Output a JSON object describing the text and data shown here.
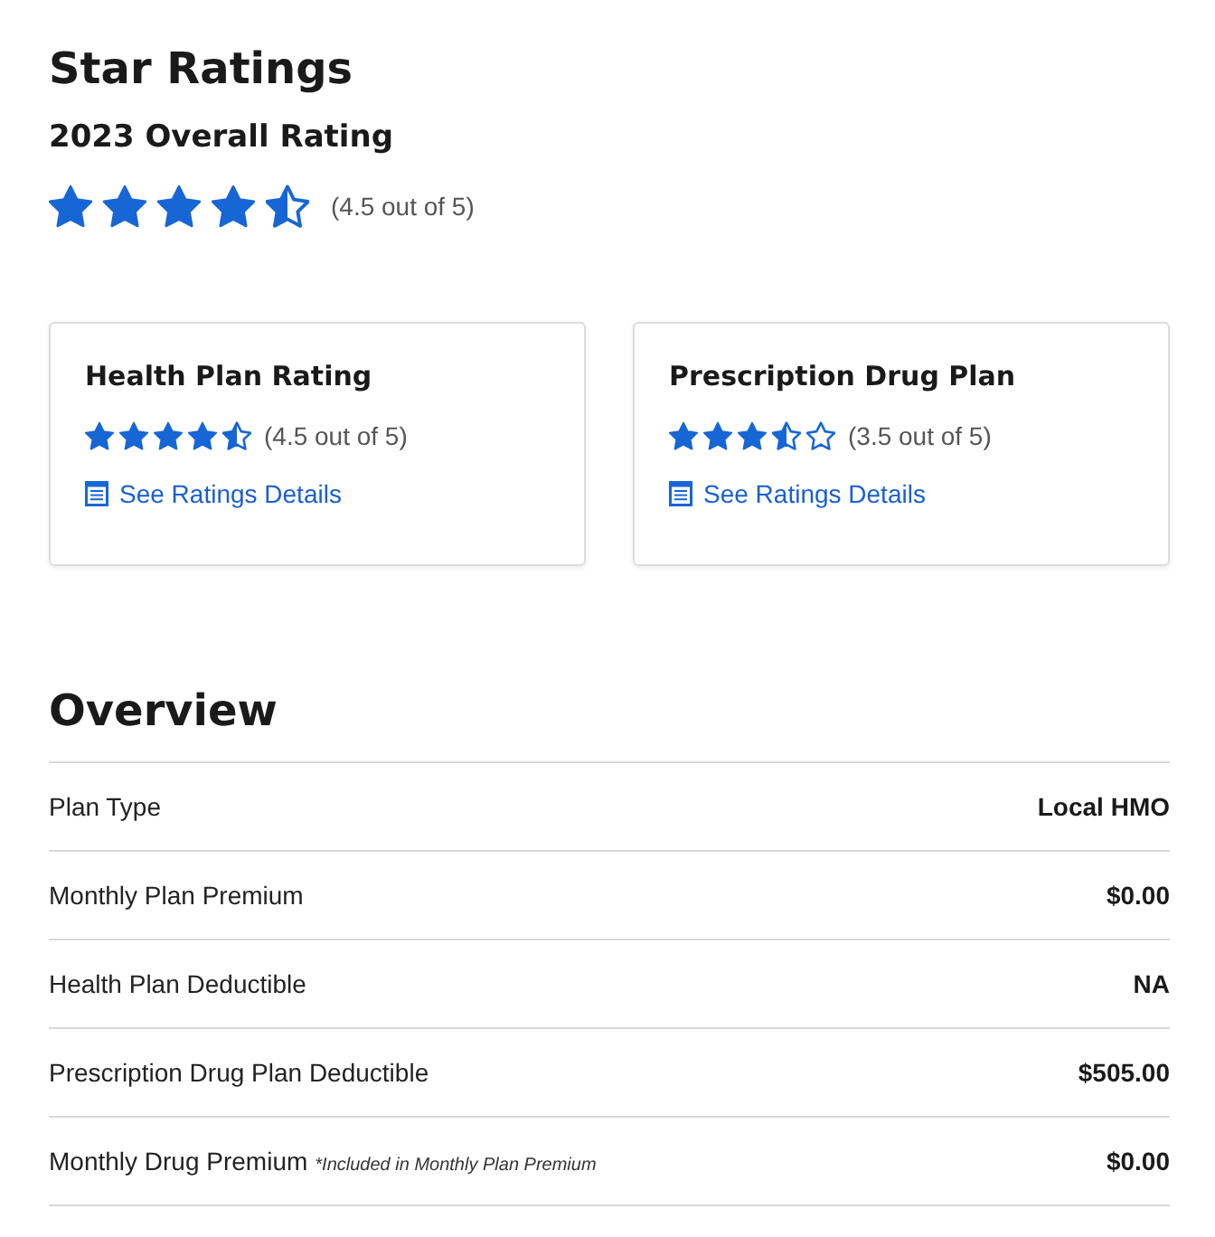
{
  "header": {
    "title": "Star Ratings",
    "subtitle": "2023 Overall Rating",
    "stars": 4.5,
    "reading": "(4.5 out of 5)"
  },
  "cards": [
    {
      "title": "Health Plan Rating",
      "stars": 4.5,
      "reading": "(4.5 out of 5)",
      "link": "See Ratings Details"
    },
    {
      "title": "Prescription Drug Plan",
      "stars": 3.5,
      "reading": "(3.5 out of 5)",
      "link": "See Ratings Details"
    }
  ],
  "overview": {
    "title": "Overview",
    "rows": [
      {
        "label": "Plan Type",
        "value": "Local HMO"
      },
      {
        "label": "Monthly Plan Premium",
        "value": "$0.00"
      },
      {
        "label": "Health Plan Deductible",
        "value": "NA"
      },
      {
        "label": "Prescription Drug Plan Deductible",
        "value": "$505.00"
      },
      {
        "label": "Monthly Drug Premium",
        "note": "*Included in Monthly Plan Premium",
        "value": "$0.00"
      }
    ]
  }
}
